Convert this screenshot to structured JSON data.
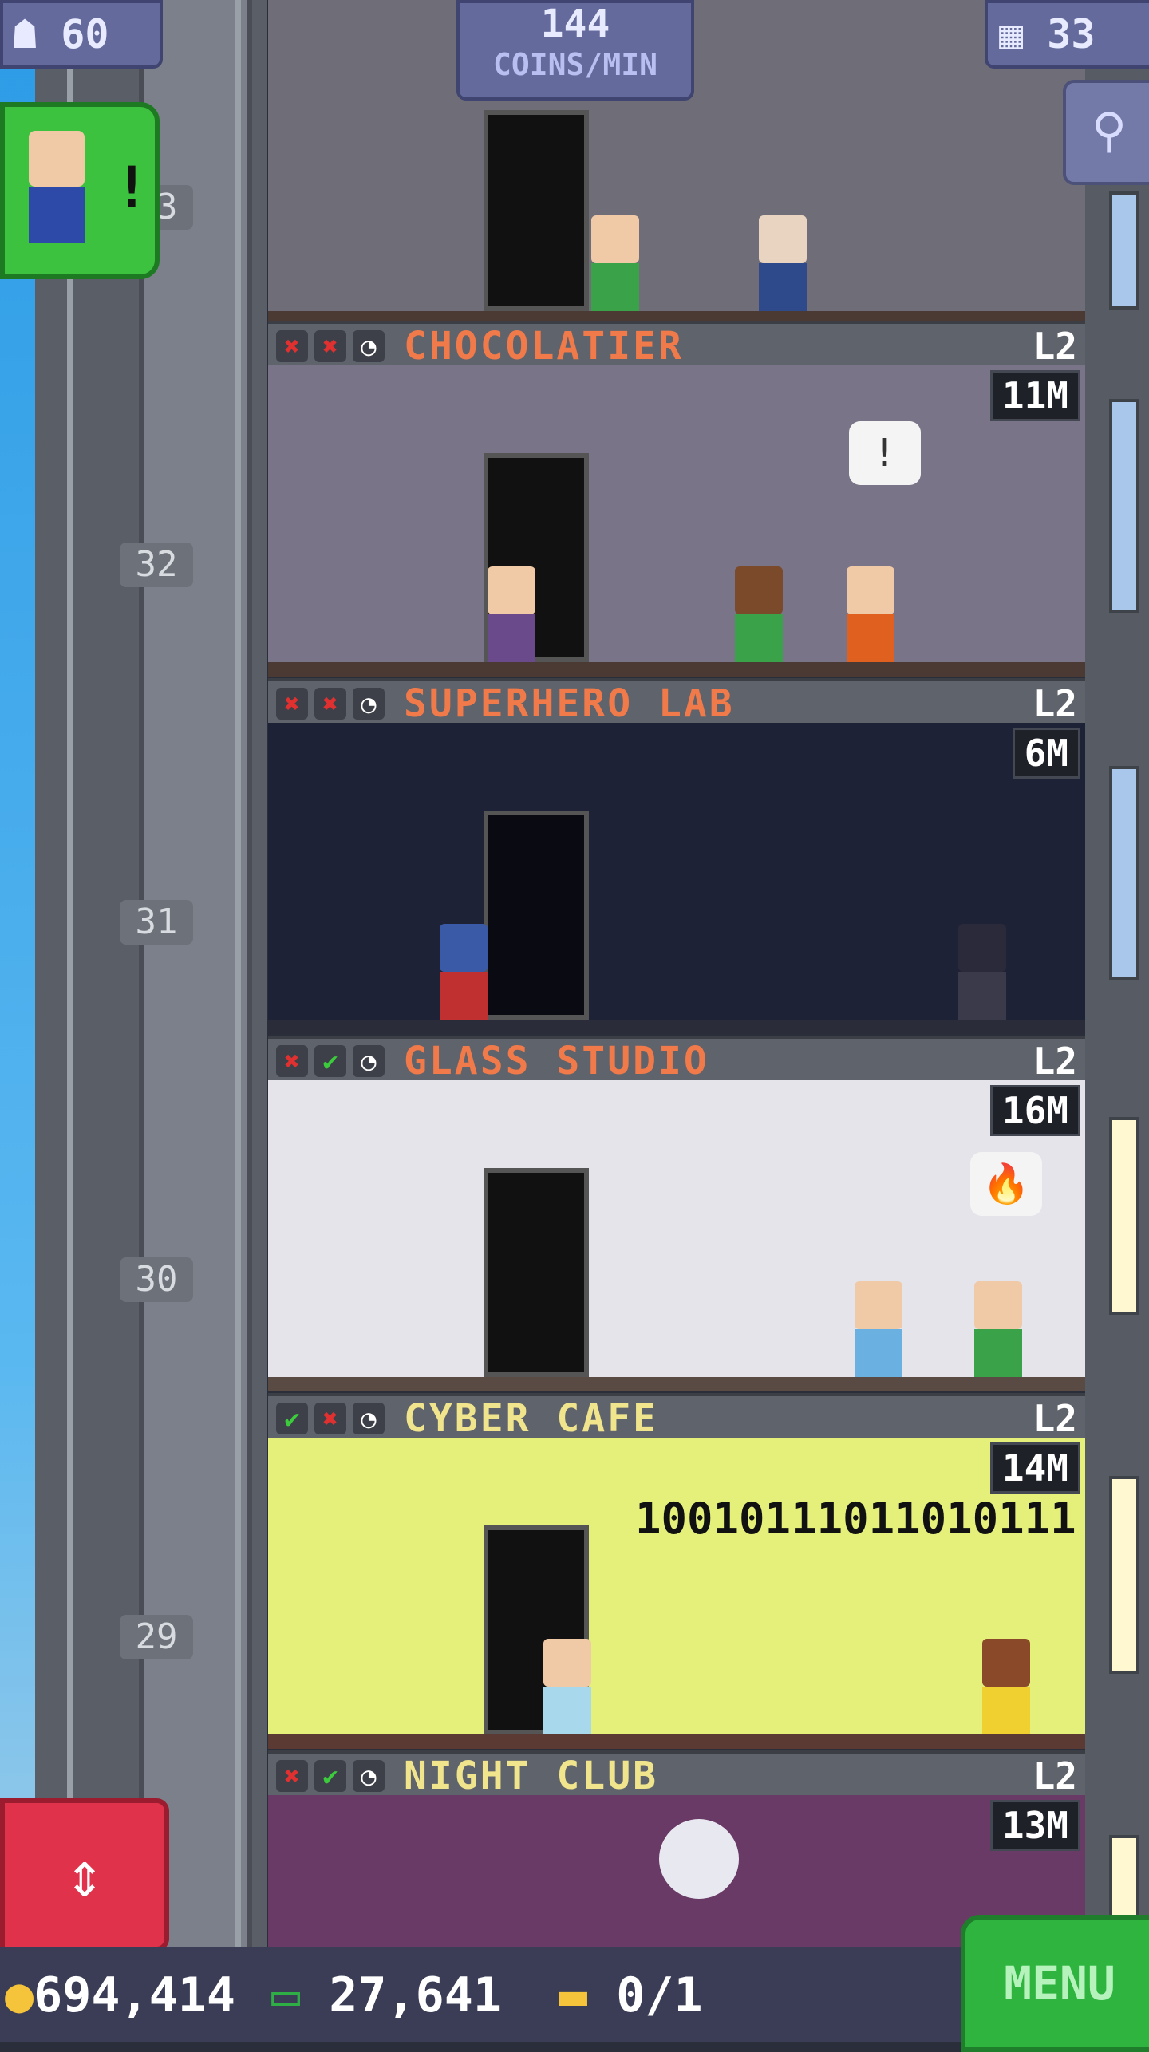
{
  "hud": {
    "population": "60",
    "coins_per_min_value": "144",
    "coins_per_min_label": "COINS/MIN",
    "floors_count": "33",
    "coins": "694,414",
    "bux": "27,641",
    "vip": "0/1",
    "menu_label": "MENU"
  },
  "elevator": {
    "floor_numbers": [
      "33",
      "32",
      "31",
      "30",
      "29"
    ]
  },
  "floors": [
    {
      "name": "CHOCOLATIER",
      "level": "L2",
      "value": "11M",
      "stats": [
        "✖",
        "✖",
        "◔"
      ],
      "stat_colors": [
        "#e03030",
        "#e03030",
        "#dddddd"
      ],
      "name_color": "#f07a4a",
      "room_bg": "#7a7488",
      "speech": "!"
    },
    {
      "name": "SUPERHERO LAB",
      "level": "L2",
      "value": "6M",
      "stats": [
        "✖",
        "✖",
        "◔"
      ],
      "stat_colors": [
        "#e03030",
        "#e03030",
        "#dddddd"
      ],
      "name_color": "#f07a4a",
      "room_bg": "#1e2236"
    },
    {
      "name": "GLASS STUDIO",
      "level": "L2",
      "value": "16M",
      "stats": [
        "✖",
        "✔",
        "◔"
      ],
      "stat_colors": [
        "#e03030",
        "#3ccb3c",
        "#dddddd"
      ],
      "name_color": "#f07a4a",
      "room_bg": "#e4e4ea",
      "speech": "🔥"
    },
    {
      "name": "CYBER CAFE",
      "level": "L2",
      "value": "14M",
      "stats": [
        "✔",
        "✖",
        "◔"
      ],
      "stat_colors": [
        "#3ccb3c",
        "#e03030",
        "#dddddd"
      ],
      "name_color": "#f0e48c",
      "room_bg": "#e4f07a",
      "binary": "10010111011010111"
    },
    {
      "name": "NIGHT CLUB",
      "level": "L2",
      "value": "13M",
      "stats": [
        "✖",
        "✔",
        "◔"
      ],
      "stat_colors": [
        "#e03030",
        "#3ccb3c",
        "#dddddd"
      ],
      "name_color": "#f0e48c",
      "room_bg": "#6a3a66"
    }
  ]
}
